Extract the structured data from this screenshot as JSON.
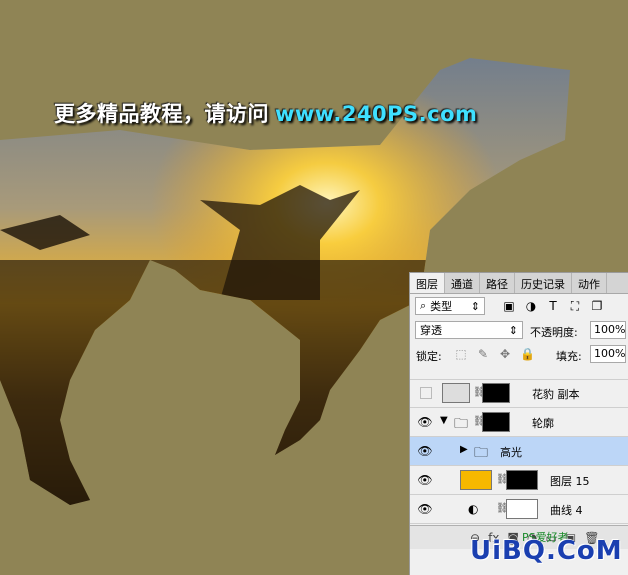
{
  "promo": {
    "text": "更多精品教程，请访问",
    "url": "www.240PS.com"
  },
  "panel": {
    "tabs": [
      "图层",
      "通道",
      "路径",
      "历史记录",
      "动作"
    ],
    "filter": {
      "label": "类型",
      "arrow": "⇕"
    },
    "blend": {
      "mode": "穿透",
      "opacity_label": "不透明度:",
      "opacity": "100%"
    },
    "lock": {
      "label": "锁定:",
      "fill_label": "填充:",
      "fill": "100%"
    },
    "layers": [
      {
        "name": "花豹 副本",
        "visible": false
      },
      {
        "name": "轮廓",
        "visible": true
      },
      {
        "name": "高光",
        "visible": true,
        "selected": true
      },
      {
        "name": "图层 15",
        "visible": true
      },
      {
        "name": "曲线 4",
        "visible": true
      }
    ],
    "bottom_icons": [
      "⊖",
      "fx",
      "◙",
      "◑",
      "▭",
      "▣",
      "🗑"
    ]
  },
  "watermark": {
    "main": "UiBQ.CoM",
    "sub": "PS爱好者"
  },
  "colors": {
    "background": "#8f8455",
    "fill_swatch": "#f6b800",
    "selection": "#bcd6f7"
  }
}
